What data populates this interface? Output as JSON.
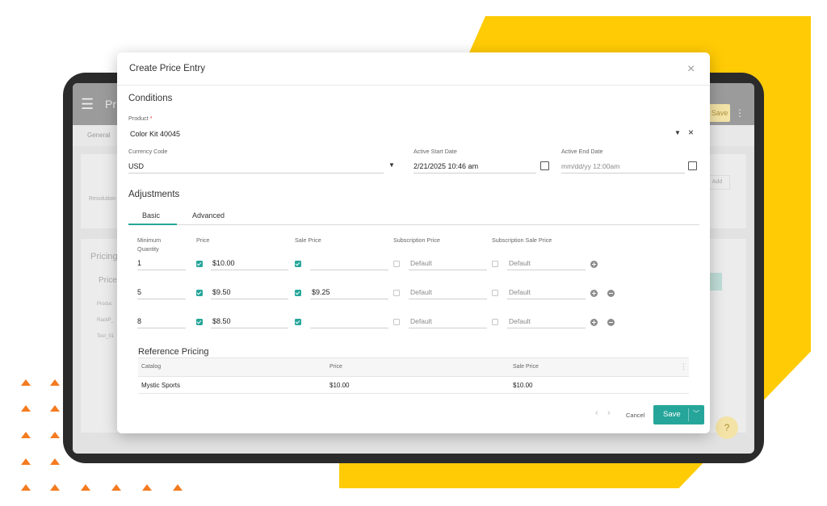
{
  "colors": {
    "accent": "#26a69a",
    "brand_yellow": "#FFCB05",
    "brand_orange": "#F47B20"
  },
  "background_app": {
    "title": "Pri",
    "save_label": "Save",
    "tab_general": "General",
    "row_label": "Resolution",
    "add_label": "Add",
    "pricing_title": "Pricing",
    "price_label": "Price",
    "rows": [
      "Produc",
      "RackP_",
      "Test_01"
    ],
    "help": "?"
  },
  "modal": {
    "title": "Create Price Entry",
    "close_icon": "×",
    "conditions": {
      "heading": "Conditions",
      "product_label": "Product",
      "product_required": "*",
      "product_value": "Color Kit 40045",
      "currency_label": "Currency Code",
      "currency_value": "USD",
      "start_label": "Active Start Date",
      "start_value": "2/21/2025 10:46 am",
      "end_label": "Active End Date",
      "end_placeholder": "mm/dd/yy 12:00am"
    },
    "adjustments": {
      "heading": "Adjustments",
      "tabs": [
        {
          "label": "Basic",
          "active": true
        },
        {
          "label": "Advanced",
          "active": false
        }
      ],
      "columns": [
        "Minimum\nQuantity",
        "Price",
        "Sale Price",
        "Subscription Price",
        "Subscription Sale Price"
      ],
      "col_min_1": "Minimum",
      "col_min_2": "Quantity",
      "rows": [
        {
          "min_qty": "1",
          "price_checked": true,
          "price": "$10.00",
          "sale_checked": true,
          "sale_price": "",
          "sub_checked": false,
          "sub_price": "Default",
          "subsale_checked": false,
          "subsale_price": "Default",
          "can_remove": false
        },
        {
          "min_qty": "5",
          "price_checked": true,
          "price": "$9.50",
          "sale_checked": true,
          "sale_price": "$9.25",
          "sub_checked": false,
          "sub_price": "Default",
          "subsale_checked": false,
          "subsale_price": "Default",
          "can_remove": true
        },
        {
          "min_qty": "8",
          "price_checked": true,
          "price": "$8.50",
          "sale_checked": true,
          "sale_price": "",
          "sub_checked": false,
          "sub_price": "Default",
          "subsale_checked": false,
          "subsale_price": "Default",
          "can_remove": true
        }
      ]
    },
    "reference": {
      "heading": "Reference Pricing",
      "columns": [
        "Catalog",
        "Price",
        "Sale Price"
      ],
      "rows": [
        {
          "catalog": "Mystic Sports",
          "price": "$10.00",
          "sale_price": "$10.00"
        }
      ]
    },
    "footer": {
      "cancel_label": "Cancel",
      "save_label": "Save"
    }
  }
}
